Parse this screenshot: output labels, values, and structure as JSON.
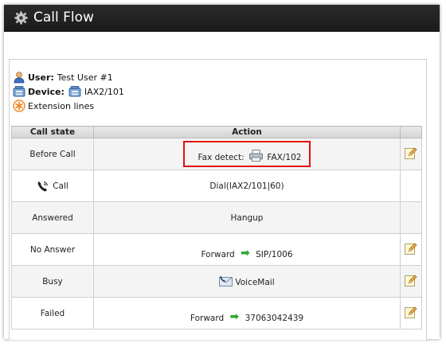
{
  "header": {
    "title": "Call Flow",
    "icon": "gear-icon"
  },
  "info": {
    "user_label": "User:",
    "user_value": "Test User #1",
    "device_label": "Device:",
    "device_value": "IAX2/101",
    "extension_lines": "Extension lines"
  },
  "table": {
    "headers": [
      "Call state",
      "Action",
      ""
    ],
    "rows": [
      {
        "state": "Before Call",
        "action_prefix": "Fax detect:",
        "action_value": "FAX/102"
      },
      {
        "state": "Call",
        "action": "Dial(IAX2/101|60)"
      },
      {
        "state": "Answered",
        "action": "Hangup"
      },
      {
        "state": "No Answer",
        "action_prefix": "Forward",
        "action_value": "SIP/1006"
      },
      {
        "state": "Busy",
        "action": "VoiceMail"
      },
      {
        "state": "Failed",
        "action_prefix": "Forward",
        "action_value": "37063042439"
      }
    ]
  },
  "colors": {
    "titlebar": "#1f1f1f",
    "highlight_border": "#e01010",
    "forward_arrow": "#2ea82e"
  }
}
